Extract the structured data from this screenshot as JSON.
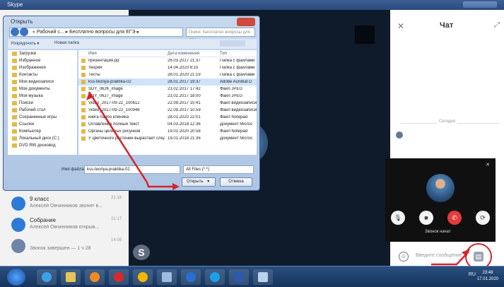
{
  "window": {
    "title": "Skype"
  },
  "dialog": {
    "title": "Открыть",
    "address": "« Рабочий с... ▸ Бесплатно вопросы для ЕГЭ ▸",
    "search_placeholder": "Поиск: Бесплатно вопросы для ЕГЭ",
    "toolbar": {
      "organize": "Упорядочить ▾",
      "new_folder": "Новая папка"
    },
    "nav_items": [
      "Загрузки",
      "Избранное",
      "Изображения",
      "Контакты",
      "Мои видеозаписи",
      "Мои документы",
      "Моя музыка",
      "Поиски",
      "Рабочий стол",
      "Сохраненные игры",
      "Ссылки",
      "Компьютер",
      "Локальный диск (C:)",
      "DVD RW дисковод"
    ],
    "columns": {
      "name": "Имя",
      "date": "Дата изменения",
      "type": "Тип"
    },
    "files": [
      {
        "name": "презентация.pp",
        "date": "26.03.2017 21:37",
        "type": "Папка с файлами"
      },
      {
        "name": "теория",
        "date": "14.04.2020 8:15",
        "type": "Папка с файлами"
      },
      {
        "name": "Тесты",
        "date": "28.01.2020 21:19",
        "type": "Папка с файлами"
      },
      {
        "name": "kss-teoriya-praktika-02",
        "date": "28.01.2017 19:37",
        "type": "Adobe Acrobat D"
      },
      {
        "name": "SDY_0626_image",
        "date": "23.02.2017 17:42",
        "type": "Файл JPEG"
      },
      {
        "name": "SDY_0627_image",
        "date": "23.02.2017 18:00",
        "type": "Файл JPEG"
      },
      {
        "name": "Video_2017-09-22_100612",
        "date": "22.09.2017 10:41",
        "type": "Файл видеозаписи"
      },
      {
        "name": "Video_2017-09-22_100948",
        "date": "22.09.2017 10:59",
        "type": "Файл видеозаписи"
      },
      {
        "name": "книга пайбо клиника",
        "date": "28.01.2020 22:01",
        "type": "Файл Notepad"
      },
      {
        "name": "Оглавление полный текст",
        "date": "04.03.2018 12:36",
        "type": "Документ Micros"
      },
      {
        "name": "Органы целевых рисунков",
        "date": "19.01.2020 20:58",
        "type": "Файл Notepad"
      },
      {
        "name": "У цветочного растений вырастает след...",
        "date": "19.01.2018 21:36",
        "type": "Документ Micros"
      }
    ],
    "filename_label": "Имя файла:",
    "filename_value": "kss-teoriya-praktika-02",
    "filter_value": "All Files (*.*)",
    "open_label": "Открыть",
    "cancel_label": "Отмена"
  },
  "conversations": [
    {
      "name": "9 класс",
      "message": "Алексей Овчинников звонит в...",
      "time": "21:18"
    },
    {
      "name": "Собрание",
      "message": "Алексей Овчинников открыв...",
      "time": "21:17"
    },
    {
      "name": "",
      "message": "Звонок завершен — 1 ч 28",
      "time": "14:08"
    }
  ],
  "center": {
    "logo": "S"
  },
  "chat": {
    "title": "Чат",
    "date_divider": "Сегодня",
    "call_label": "Звонок начат",
    "input_placeholder": "Введите сообщение"
  },
  "taskbar": {
    "tray_lang": "RU",
    "clock_time": "23:48",
    "clock_date": "17.01.2020"
  },
  "colors": {
    "annotation_red": "#d4242b",
    "skype_blue": "#2e7bd6",
    "end_call_red": "#e43b3b"
  }
}
